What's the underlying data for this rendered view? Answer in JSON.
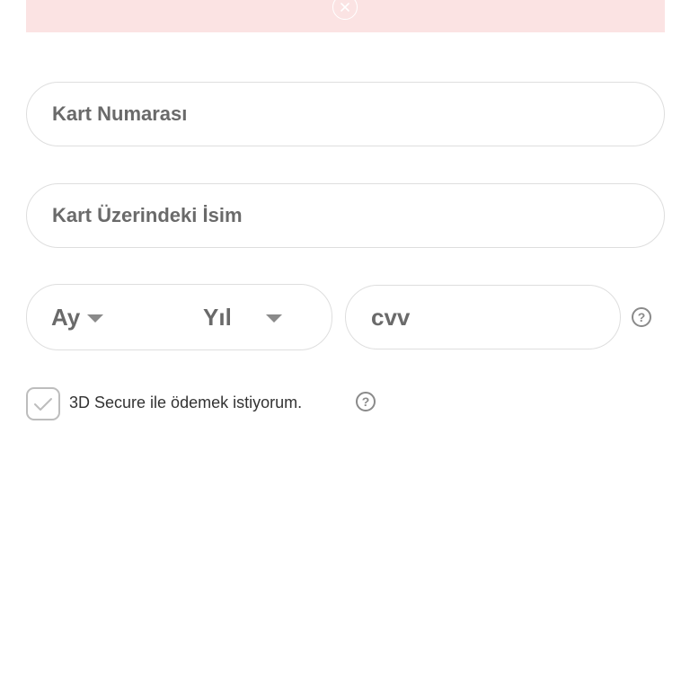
{
  "alert": {
    "close_icon": "close-circle-icon",
    "background": "#fbe3e3"
  },
  "form": {
    "card_number": {
      "placeholder": "Kart Numarası",
      "value": ""
    },
    "card_holder": {
      "placeholder": "Kart Üzerindeki İsim",
      "value": ""
    },
    "expiry_month": {
      "label": "Ay"
    },
    "expiry_year": {
      "label": "Yıl"
    },
    "cvv": {
      "placeholder": "cvv",
      "value": ""
    },
    "secure_3d": {
      "label": "3D Secure ile ödemek istiyorum.",
      "checked": true
    }
  },
  "icons": {
    "help": "?"
  },
  "colors": {
    "border": "#dedede",
    "placeholder": "#6a6a6a",
    "text": "#333333",
    "icon": "#8a8a8a"
  }
}
